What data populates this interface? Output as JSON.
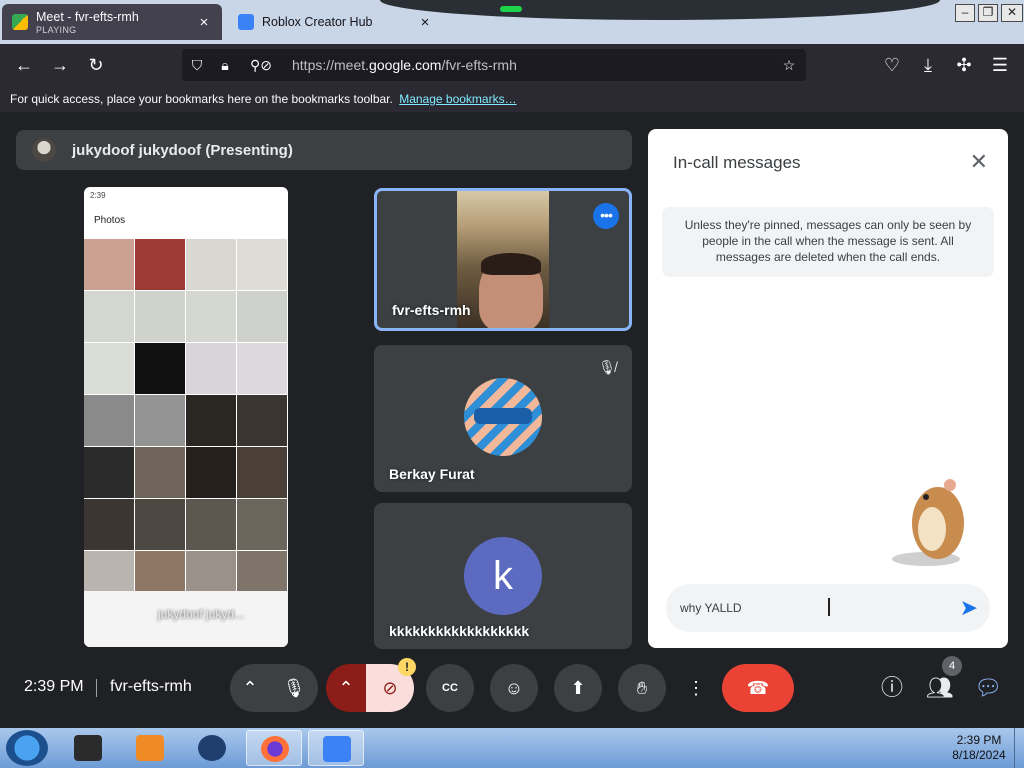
{
  "browser": {
    "tabs": [
      {
        "title": "Meet - fvr-efts-rmh",
        "subtitle": "PLAYING",
        "close": "×"
      },
      {
        "title": "Roblox Creator Hub",
        "close": "×"
      }
    ],
    "url_prefix": "https://meet.",
    "url_domain": "google.com",
    "url_path": "/fvr-efts-rmh",
    "bookmarks_text": "For quick access, place your bookmarks here on the bookmarks toolbar.",
    "bookmarks_link": "Manage bookmarks…"
  },
  "meet": {
    "presenter_label": "jukydoof jukydoof (Presenting)",
    "screen_share": {
      "status_time": "2:39",
      "app_title": "Photos",
      "overlay_name": "jukydoof jukyd..."
    },
    "tiles": [
      {
        "name": "fvr-efts-rmh",
        "more_label": "•••"
      },
      {
        "name": "Berkay Furat"
      },
      {
        "name": "kkkkkkkkkkkkkkkkkk",
        "initial": "k"
      }
    ],
    "chat": {
      "title": "In-call messages",
      "notice": "Unless they're pinned, messages can only be seen by people in the call when the message is sent. All messages are deleted when the call ends.",
      "input_value": "why YALLD"
    },
    "controls": {
      "time": "2:39 PM",
      "meeting_code": "fvr-efts-rmh",
      "warning_badge": "!",
      "people_count": "4",
      "ack_label": "CC"
    }
  },
  "taskbar": {
    "clock_time": "2:39 PM",
    "clock_date": "8/18/2024"
  },
  "colors": {
    "meet_bg": "#202124",
    "tile_bg": "#3c4043",
    "accent_blue": "#1a73e8",
    "active_border": "#8ab4f8",
    "hangup_red": "#ea4335"
  }
}
